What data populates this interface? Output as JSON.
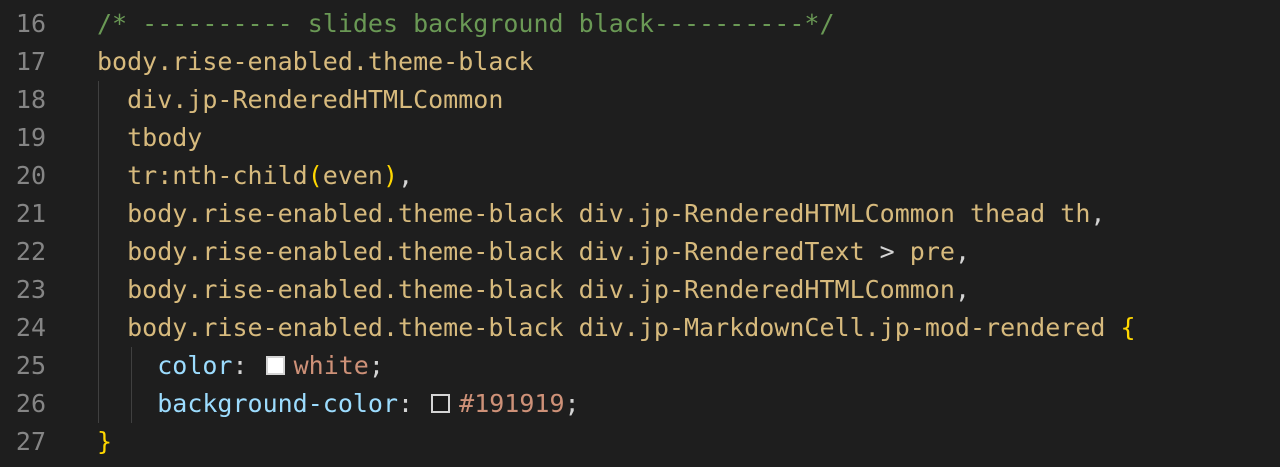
{
  "editor": {
    "lines": [
      {
        "num": "16",
        "parts": [
          {
            "t": "/* ---------- slides background black----------*/",
            "c": "comment"
          }
        ]
      },
      {
        "num": "17",
        "parts": [
          {
            "t": "body.rise-enabled.theme-black",
            "c": "sel"
          }
        ]
      },
      {
        "num": "18",
        "parts": [
          {
            "t": "  div.jp-RenderedHTMLCommon",
            "c": "sel"
          }
        ]
      },
      {
        "num": "19",
        "parts": [
          {
            "t": "  tbody",
            "c": "sel"
          }
        ]
      },
      {
        "num": "20",
        "parts": [
          {
            "t": "  tr:nth-child",
            "c": "sel"
          },
          {
            "t": "(",
            "c": "brace"
          },
          {
            "t": "even",
            "c": "sel"
          },
          {
            "t": ")",
            "c": "brace"
          },
          {
            "t": ",",
            "c": "punct"
          }
        ]
      },
      {
        "num": "21",
        "parts": [
          {
            "t": "  body.rise-enabled.theme-black div.jp-RenderedHTMLCommon thead th",
            "c": "sel"
          },
          {
            "t": ",",
            "c": "punct"
          }
        ]
      },
      {
        "num": "22",
        "parts": [
          {
            "t": "  body.rise-enabled.theme-black div.jp-RenderedText ",
            "c": "sel"
          },
          {
            "t": ">",
            "c": "punct"
          },
          {
            "t": " pre",
            "c": "sel"
          },
          {
            "t": ",",
            "c": "punct"
          }
        ]
      },
      {
        "num": "23",
        "parts": [
          {
            "t": "  body.rise-enabled.theme-black div.jp-RenderedHTMLCommon",
            "c": "sel"
          },
          {
            "t": ",",
            "c": "punct"
          }
        ]
      },
      {
        "num": "24",
        "parts": [
          {
            "t": "  body.rise-enabled.theme-black div.jp-MarkdownCell.jp-mod-rendered ",
            "c": "sel"
          },
          {
            "t": "{",
            "c": "brace"
          }
        ]
      },
      {
        "num": "25",
        "parts": [
          {
            "t": "    ",
            "c": "punct"
          },
          {
            "t": "color",
            "c": "prop"
          },
          {
            "t": ": ",
            "c": "punct"
          },
          {
            "swatch": "#ffffff"
          },
          {
            "t": "white",
            "c": "val"
          },
          {
            "t": ";",
            "c": "punct"
          }
        ]
      },
      {
        "num": "26",
        "parts": [
          {
            "t": "    ",
            "c": "punct"
          },
          {
            "t": "background-color",
            "c": "prop"
          },
          {
            "t": ": ",
            "c": "punct"
          },
          {
            "swatch": "#191919"
          },
          {
            "t": "#191919",
            "c": "val"
          },
          {
            "t": ";",
            "c": "punct"
          }
        ]
      },
      {
        "num": "27",
        "parts": [
          {
            "t": "}",
            "c": "brace"
          }
        ]
      }
    ]
  },
  "colors": {
    "background": "#1e1e1e",
    "line_number": "#858585",
    "comment": "#6a9955",
    "selector": "#d7ba7d",
    "property": "#9cdcfe",
    "value": "#ce9178",
    "bracket": "#ffd700"
  }
}
